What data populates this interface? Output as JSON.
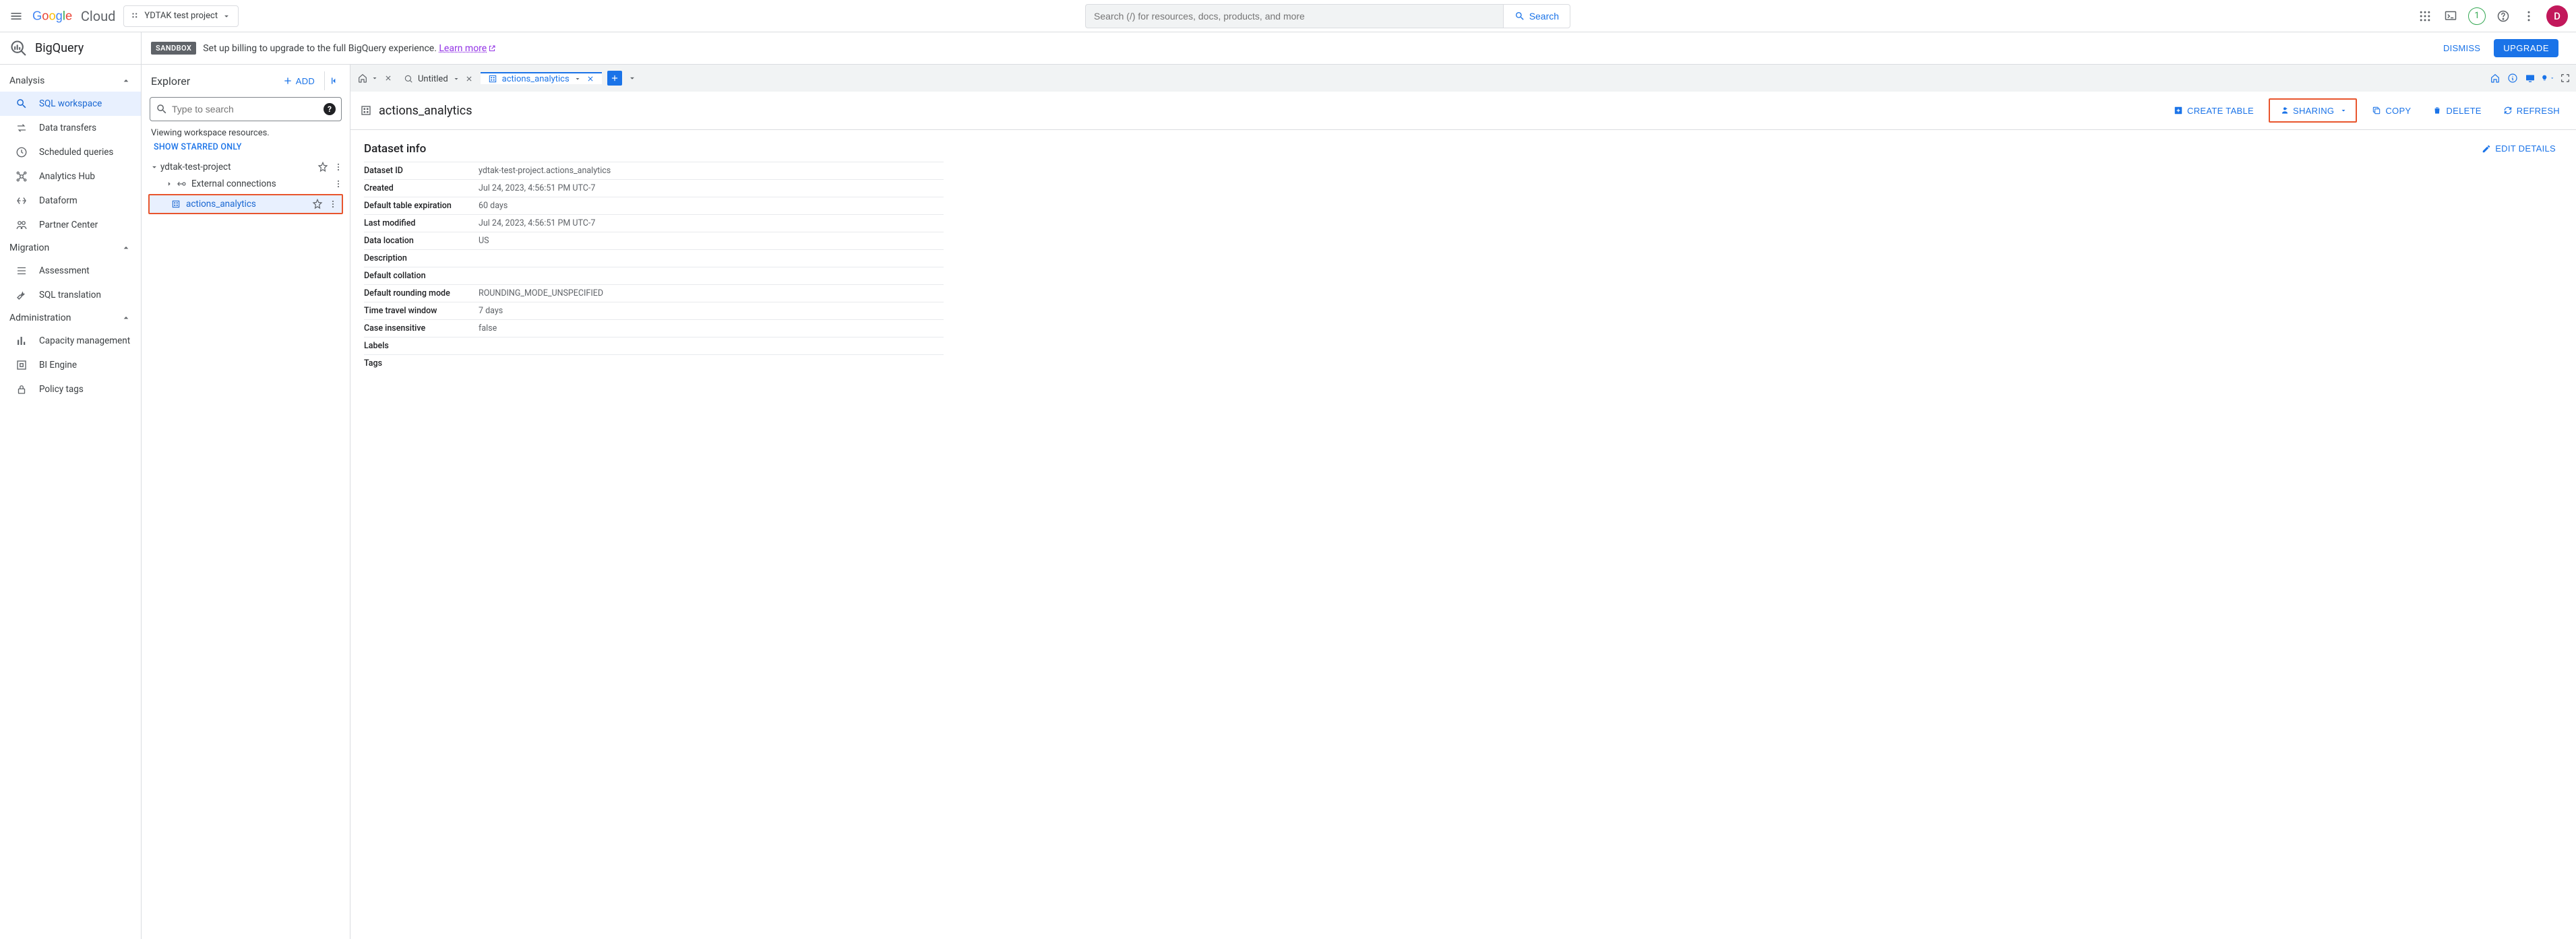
{
  "header": {
    "cloud_label": "Cloud",
    "project_name": "YDTAK test project",
    "search_placeholder": "Search (/) for resources, docs, products, and more",
    "search_button": "Search",
    "notification_count": "1",
    "avatar_letter": "D"
  },
  "product": {
    "name": "BigQuery",
    "sandbox_badge": "SANDBOX",
    "sandbox_text": "Set up billing to upgrade to the full BigQuery experience. ",
    "learn_more": "Learn more",
    "dismiss": "DISMISS",
    "upgrade": "UPGRADE"
  },
  "nav": {
    "sections": [
      {
        "title": "Analysis",
        "items": [
          {
            "label": "SQL workspace",
            "active": true,
            "icon": "search"
          },
          {
            "label": "Data transfers",
            "active": false,
            "icon": "swap"
          },
          {
            "label": "Scheduled queries",
            "active": false,
            "icon": "clock"
          },
          {
            "label": "Analytics Hub",
            "active": false,
            "icon": "hub"
          },
          {
            "label": "Dataform",
            "active": false,
            "icon": "dataform"
          },
          {
            "label": "Partner Center",
            "active": false,
            "icon": "partner"
          }
        ]
      },
      {
        "title": "Migration",
        "items": [
          {
            "label": "Assessment",
            "active": false,
            "icon": "list"
          },
          {
            "label": "SQL translation",
            "active": false,
            "icon": "wrench"
          }
        ]
      },
      {
        "title": "Administration",
        "items": [
          {
            "label": "Capacity management",
            "active": false,
            "icon": "bars"
          },
          {
            "label": "BI Engine",
            "active": false,
            "icon": "engine"
          },
          {
            "label": "Policy tags",
            "active": false,
            "icon": "lock"
          }
        ]
      }
    ]
  },
  "explorer": {
    "title": "Explorer",
    "add": "ADD",
    "search_placeholder": "Type to search",
    "viewing_text": "Viewing workspace resources.",
    "starred_link": "SHOW STARRED ONLY",
    "project_node": "ydtak-test-project",
    "external_conn": "External connections",
    "dataset_node": "actions_analytics"
  },
  "tabs": {
    "untitled": "Untitled",
    "actions": "actions_analytics"
  },
  "content": {
    "title": "actions_analytics",
    "actions": {
      "create_table": "CREATE TABLE",
      "sharing": "SHARING",
      "copy": "COPY",
      "delete": "DELETE",
      "refresh": "REFRESH"
    },
    "panel_title": "Dataset info",
    "edit_details": "EDIT DETAILS",
    "info": [
      {
        "k": "Dataset ID",
        "v": "ydtak-test-project.actions_analytics"
      },
      {
        "k": "Created",
        "v": "Jul 24, 2023, 4:56:51 PM UTC-7"
      },
      {
        "k": "Default table expiration",
        "v": "60 days"
      },
      {
        "k": "Last modified",
        "v": "Jul 24, 2023, 4:56:51 PM UTC-7"
      },
      {
        "k": "Data location",
        "v": "US"
      },
      {
        "k": "Description",
        "v": ""
      },
      {
        "k": "Default collation",
        "v": ""
      },
      {
        "k": "Default rounding mode",
        "v": "ROUNDING_MODE_UNSPECIFIED"
      },
      {
        "k": "Time travel window",
        "v": "7 days"
      },
      {
        "k": "Case insensitive",
        "v": "false"
      },
      {
        "k": "Labels",
        "v": ""
      },
      {
        "k": "Tags",
        "v": ""
      }
    ]
  }
}
